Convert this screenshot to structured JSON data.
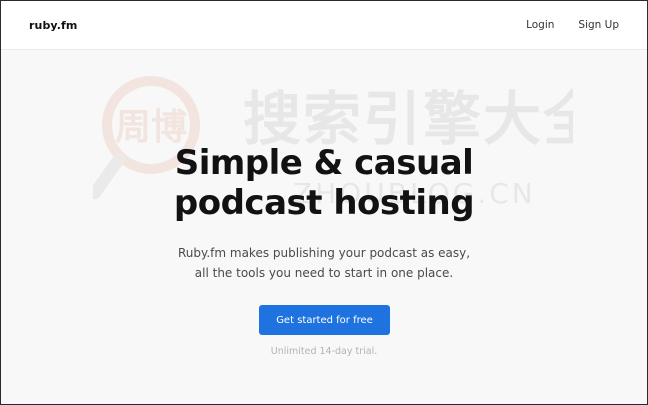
{
  "header": {
    "brand": "ruby.fm",
    "login": "Login",
    "signup": "Sign Up"
  },
  "hero": {
    "title_line1": "Simple & casual",
    "title_line2": "podcast hosting",
    "subtitle_line1": "Ruby.fm makes publishing your podcast as easy,",
    "subtitle_line2": "all the tools you need to start in one place."
  },
  "cta": {
    "label": "Get started for free",
    "note": "Unlimited 14-day trial."
  },
  "watermark": {
    "text": "搜索引擎大全",
    "domain": "ZHOUBLOG.CN",
    "seal": "周博"
  },
  "colors": {
    "accent": "#1e73e0",
    "background": "#f8f8f8",
    "header_bg": "#ffffff"
  }
}
